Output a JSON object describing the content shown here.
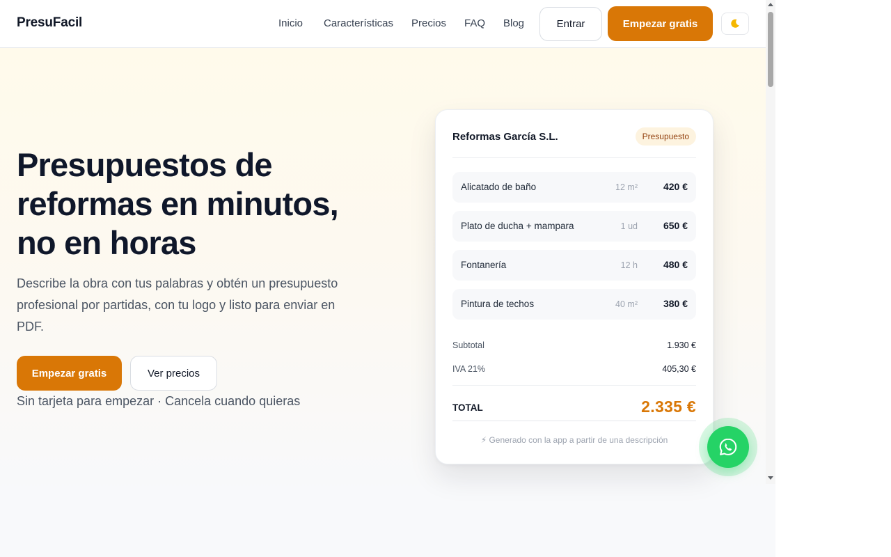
{
  "header": {
    "brand": "PresuFacil",
    "nav": [
      "Inicio",
      "Características",
      "Precios",
      "FAQ",
      "Blog"
    ],
    "login_label": "Entrar",
    "cta_label": "Empezar gratis",
    "theme_icon": "moon-icon"
  },
  "hero": {
    "title": "Presupuestos de reformas en minutos, no en horas",
    "subtitle": "Describe la obra con tus palabras y obtén un presupuesto profesional por partidas, con tu logo y listo para enviar en PDF.",
    "primary_cta": "Empezar gratis",
    "secondary_cta": "Ver precios",
    "note": "Sin tarjeta para empezar · Cancela cuando quieras"
  },
  "quote_card": {
    "company": "Reformas García S.L.",
    "badge": "Presupuesto",
    "items": [
      {
        "name": "Alicatado de baño",
        "qty": "12 m²",
        "price": "420 €"
      },
      {
        "name": "Plato de ducha + mampara",
        "qty": "1 ud",
        "price": "650 €"
      },
      {
        "name": "Fontanería",
        "qty": "12 h",
        "price": "480 €"
      },
      {
        "name": "Pintura de techos",
        "qty": "40 m²",
        "price": "380 €"
      }
    ],
    "subtotal_label": "Subtotal",
    "subtotal_value": "1.930 €",
    "vat_label": "IVA 21%",
    "vat_value": "405,30 €",
    "total_label": "TOTAL",
    "total_value": "2.335 €",
    "footer": "⚡ Generado con la app a partir de una descripción"
  },
  "floating": {
    "whatsapp_icon": "whatsapp-icon"
  },
  "colors": {
    "accent": "#d97706",
    "whatsapp": "#25d366",
    "text_dark": "#0f172a"
  }
}
